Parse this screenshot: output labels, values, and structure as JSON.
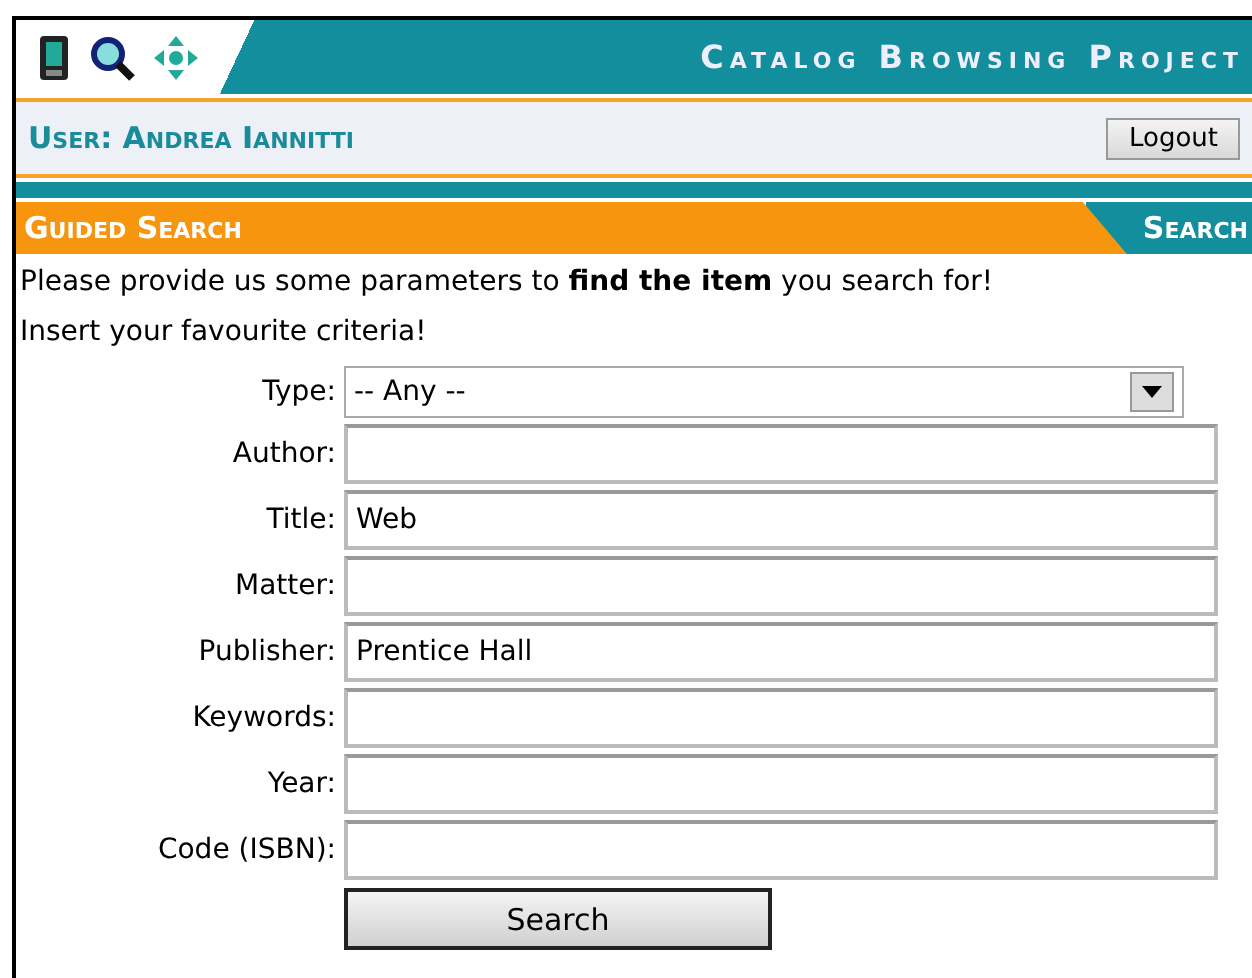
{
  "header": {
    "title": "Catalog Browsing Project"
  },
  "user_bar": {
    "user": "User: Andrea Iannitti",
    "logout": "Logout"
  },
  "section_bar": {
    "title": "Guided Search",
    "tab": "Search"
  },
  "intro": [
    "Please provide us some parameters to **find the item** you search for!",
    "Insert your favourite criteria!"
  ],
  "fields": [
    {
      "kind": "select",
      "label": "Type:",
      "value": "-- Any --"
    },
    {
      "kind": "text",
      "label": "Author:"
    },
    {
      "kind": "text",
      "label": "Title:",
      "value": "Web"
    },
    {
      "kind": "text",
      "label": "Matter:"
    },
    {
      "kind": "text",
      "label": "Publisher:",
      "value": "Prentice Hall"
    },
    {
      "kind": "text",
      "label": "Keywords:"
    },
    {
      "kind": "text",
      "label": "Year:"
    },
    {
      "kind": "text",
      "label": "Code (ISBN):"
    }
  ],
  "submit": "Search"
}
